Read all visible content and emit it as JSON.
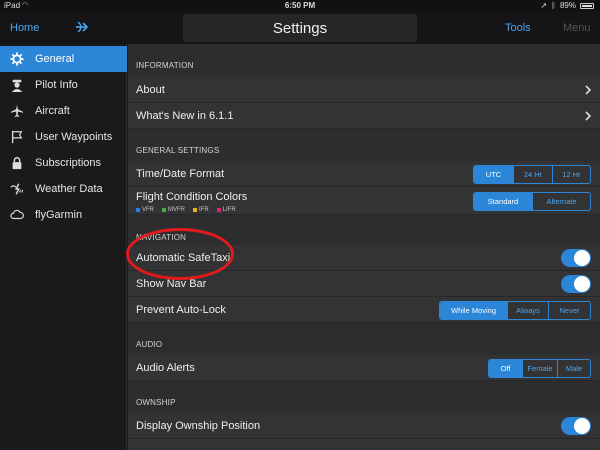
{
  "status_bar": {
    "carrier": "iPad",
    "time": "6:50 PM",
    "battery": "89%"
  },
  "nav_bar": {
    "home": "Home",
    "title": "Settings",
    "tools": "Tools",
    "menu": "Menu"
  },
  "sidebar": {
    "items": [
      {
        "label": "General",
        "icon": "gear-icon",
        "active": true
      },
      {
        "label": "Pilot Info",
        "icon": "pilot-icon",
        "active": false
      },
      {
        "label": "Aircraft",
        "icon": "airplane-icon",
        "active": false
      },
      {
        "label": "User Waypoints",
        "icon": "flag-icon",
        "active": false
      },
      {
        "label": "Subscriptions",
        "icon": "lock-icon",
        "active": false
      },
      {
        "label": "Weather Data",
        "icon": "weather-icon",
        "active": false
      },
      {
        "label": "flyGarmin",
        "icon": "cloud-icon",
        "active": false
      }
    ]
  },
  "sections": {
    "information": "INFORMATION",
    "general_settings": "GENERAL SETTINGS",
    "navigation": "NAVIGATION",
    "audio": "AUDIO",
    "ownship": "OWNSHIP"
  },
  "rows": {
    "about": "About",
    "whats_new": "What's New in 6.1.1",
    "time_date_format": "Time/Date Format",
    "flight_condition_colors": "Flight Condition Colors",
    "automatic_safetaxi": "Automatic SafeTaxi",
    "show_nav_bar": "Show Nav Bar",
    "prevent_auto_lock": "Prevent Auto-Lock",
    "audio_alerts": "Audio Alerts",
    "display_ownship_position": "Display Ownship Position"
  },
  "time_format_options": [
    "UTC",
    "24 Hr",
    "12 Hr"
  ],
  "flight_color_options": [
    "Standard",
    "Alternate"
  ],
  "auto_lock_options": [
    "While Moving",
    "Always",
    "Never"
  ],
  "audio_alert_options": [
    "Off",
    "Female",
    "Male"
  ],
  "legend": [
    {
      "label": "VFR",
      "color": "#2a7de1"
    },
    {
      "label": "MVFR",
      "color": "#3cb043"
    },
    {
      "label": "IFR",
      "color": "#e0b21b"
    },
    {
      "label": "LIFR",
      "color": "#d9286b"
    }
  ],
  "colors": {
    "accent": "#2b86d8",
    "highlight_circle": "#e11b1b"
  }
}
